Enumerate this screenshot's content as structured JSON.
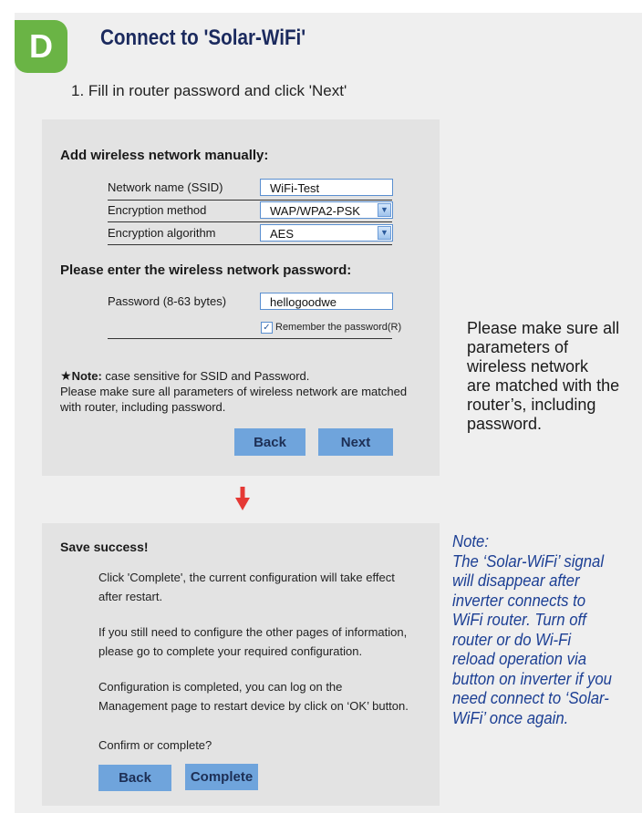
{
  "section_badge": "D",
  "title": "Connect to 'Solar-WiFi'",
  "step": "1. Fill in router password and click 'Next'",
  "form": {
    "heading": "Add wireless network manually:",
    "ssid_label": "Network name (SSID)",
    "ssid_value": "WiFi-Test",
    "encryption_label": "Encryption method",
    "encryption_value": "WAP/WPA2-PSK",
    "algorithm_label": "Encryption algorithm",
    "algorithm_value": "AES",
    "password_heading": "Please enter the wireless network password:",
    "password_label": "Password (8-63 bytes)",
    "password_value": "hellogoodwe",
    "remember_label": "Remember the password(R)",
    "remember_checked": true,
    "note_star": "★",
    "note_bold": "Note:",
    "note_rest": " case sensitive for SSID and Password.",
    "note_line2": "Please make sure all parameters of wireless network are matched",
    "note_line3": "with router, including password.",
    "back_label": "Back",
    "next_label": "Next"
  },
  "side_text": [
    "Please make sure all",
    "parameters of",
    "wireless network",
    "are matched with the",
    "router’s, including",
    "password."
  ],
  "success": {
    "heading": "Save success!",
    "para1": [
      "Click 'Complete', the current configuration will take effect",
      "after restart."
    ],
    "para2": [
      "If you still need to configure the other pages of information,",
      "please go to complete your required configuration."
    ],
    "para3": [
      "Configuration is completed, you can log on the",
      "Management page to restart device by click on ‘OK’ button."
    ],
    "para4": "Confirm or complete?",
    "back_label": "Back",
    "complete_label": "Complete"
  },
  "side_note": [
    "Note:",
    "The ‘Solar-WiFi’ signal",
    "will disappear after",
    "inverter connects to",
    "WiFi router. Turn off",
    "router or do Wi-Fi",
    "reload operation via",
    "button on inverter if you",
    "need connect to  ‘Solar-",
    "WiFi’  once again."
  ],
  "colors": {
    "badge": "#6ab445",
    "title": "#1b2a5e",
    "button": "#6fa4dc",
    "arrow": "#e53935",
    "note": "#1c3f94"
  }
}
